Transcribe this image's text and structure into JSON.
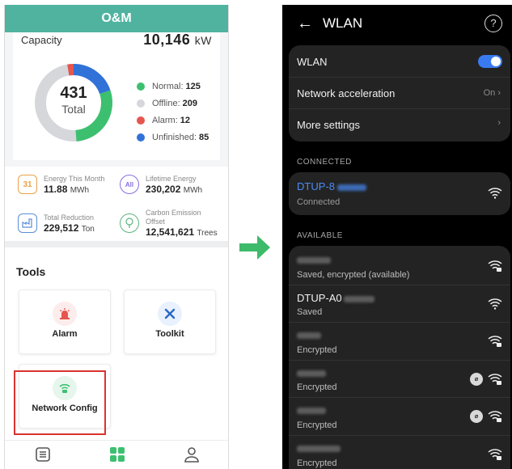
{
  "app": {
    "title": "O&M",
    "capacity_label": "Capacity",
    "capacity_value": "10,146",
    "capacity_unit": "kW",
    "donut": {
      "total": "431",
      "total_label": "Total",
      "legend": [
        {
          "label": "Normal:",
          "value": "125",
          "color": "#3cc070"
        },
        {
          "label": "Offline:",
          "value": "209",
          "color": "#d5d7db"
        },
        {
          "label": "Alarm:",
          "value": "12",
          "color": "#e6554f"
        },
        {
          "label": "Unfinished:",
          "value": "85",
          "color": "#3072d8"
        }
      ]
    },
    "stats": {
      "energy_month": {
        "label": "Energy This Month",
        "value": "11.88",
        "unit": "MWh",
        "icon_text": "31"
      },
      "lifetime": {
        "label": "Lifetime Energy",
        "value": "230,202",
        "unit": "MWh",
        "icon_text": "All"
      },
      "reduction": {
        "label": "Total Reduction",
        "value": "229,512",
        "unit": "Ton"
      },
      "carbon": {
        "label_line1": "Carbon Emission",
        "label_line2": "Offset",
        "value": "12,541,621",
        "unit": "Trees"
      }
    },
    "tools_title": "Tools",
    "tools": [
      {
        "label": "Alarm",
        "icon": "alarm-icon"
      },
      {
        "label": "Toolkit",
        "icon": "toolkit-icon"
      },
      {
        "label": "Network Config",
        "icon": "network-config-icon"
      }
    ],
    "colors": {
      "header": "#4fb3a0",
      "accent": "#3cc070",
      "highlight": "#d9332f"
    }
  },
  "wlan": {
    "title": "WLAN",
    "wlan_label": "WLAN",
    "wlan_enabled": true,
    "net_accel_label": "Network acceleration",
    "net_accel_value": "On",
    "more_settings_label": "More settings",
    "connected_header": "CONNECTED",
    "connected": {
      "ssid": "DTUP-8",
      "status": "Connected"
    },
    "available_header": "AVAILABLE",
    "available": [
      {
        "ssid": "",
        "status": "Saved, encrypted (available)"
      },
      {
        "ssid": "DTUP-A0",
        "status": "Saved"
      },
      {
        "ssid": "",
        "status": "Encrypted"
      },
      {
        "ssid": "",
        "status": "Encrypted"
      },
      {
        "ssid": "",
        "status": "Encrypted"
      },
      {
        "ssid": "",
        "status": "Encrypted"
      }
    ],
    "colors": {
      "toggle": "#3a7af0",
      "connected_text": "#4a8cf5"
    }
  },
  "arrow_color": "#3dbb6a"
}
